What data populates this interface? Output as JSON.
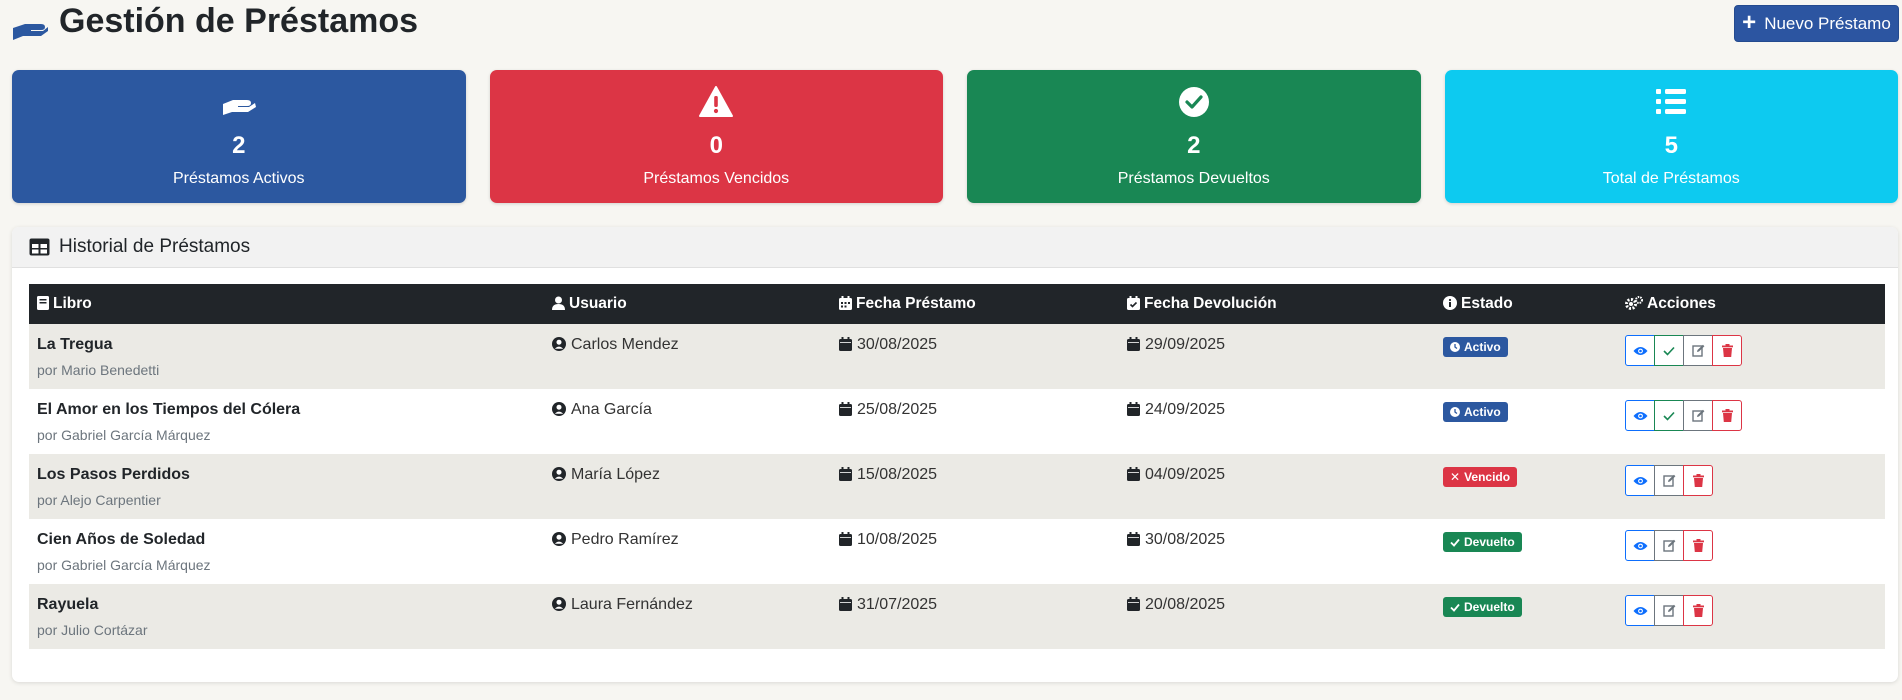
{
  "header": {
    "title": "Gestión de Préstamos",
    "new_button": "Nuevo Préstamo"
  },
  "stats": [
    {
      "value": "2",
      "label": "Préstamos Activos",
      "icon": "hand-icon",
      "color": "#2c58a0"
    },
    {
      "value": "0",
      "label": "Préstamos Vencidos",
      "icon": "warning-icon",
      "color": "#dc3545"
    },
    {
      "value": "2",
      "label": "Préstamos Devueltos",
      "icon": "check-circle-icon",
      "color": "#198754"
    },
    {
      "value": "5",
      "label": "Total de Préstamos",
      "icon": "list-icon",
      "color": "#0dcaf0"
    }
  ],
  "history": {
    "title": "Historial de Préstamos",
    "columns": {
      "libro": "Libro",
      "usuario": "Usuario",
      "fecha_prestamo": "Fecha Préstamo",
      "fecha_devolucion": "Fecha Devolución",
      "estado": "Estado",
      "acciones": "Acciones"
    },
    "rows": [
      {
        "title": "La Tregua",
        "author": "por Mario Benedetti",
        "user": "Carlos Mendez",
        "loan_date": "30/08/2025",
        "return_date": "29/09/2025",
        "status": "Activo",
        "status_type": "activo"
      },
      {
        "title": "El Amor en los Tiempos del Cólera",
        "author": "por Gabriel García Márquez",
        "user": "Ana García",
        "loan_date": "25/08/2025",
        "return_date": "24/09/2025",
        "status": "Activo",
        "status_type": "activo"
      },
      {
        "title": "Los Pasos Perdidos",
        "author": "por Alejo Carpentier",
        "user": "María López",
        "loan_date": "15/08/2025",
        "return_date": "04/09/2025",
        "status": "Vencido",
        "status_type": "vencido"
      },
      {
        "title": "Cien Años de Soledad",
        "author": "por Gabriel García Márquez",
        "user": "Pedro Ramírez",
        "loan_date": "10/08/2025",
        "return_date": "30/08/2025",
        "status": "Devuelto",
        "status_type": "devuelto"
      },
      {
        "title": "Rayuela",
        "author": "por Julio Cortázar",
        "user": "Laura Fernández",
        "loan_date": "31/07/2025",
        "return_date": "20/08/2025",
        "status": "Devuelto",
        "status_type": "devuelto"
      }
    ]
  }
}
